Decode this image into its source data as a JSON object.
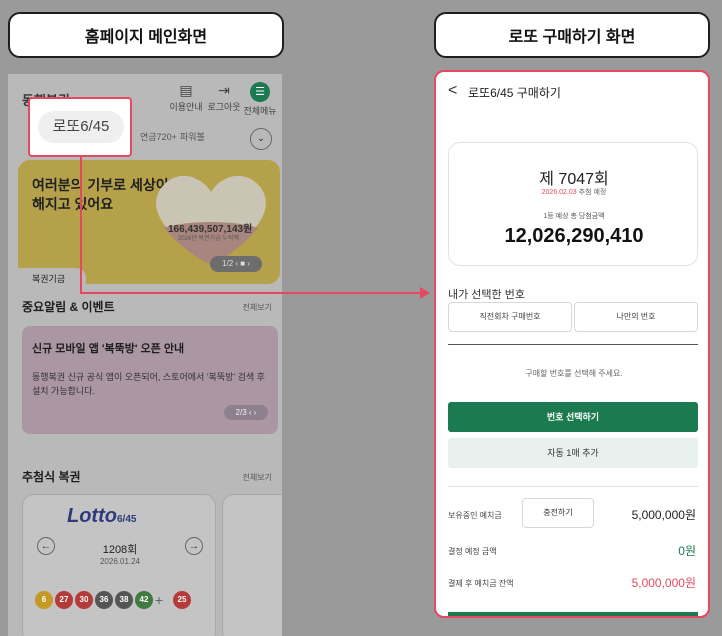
{
  "labels": {
    "left": "홈페이지 메인화면",
    "right": "로또 구매하기 화면"
  },
  "colors": {
    "accent_green": "#1b7a4f",
    "highlight_red": "#e5495f"
  },
  "home": {
    "logo": "동행복권",
    "header_icons": [
      {
        "icon": "book-icon",
        "label": "이용안내"
      },
      {
        "icon": "logout-icon",
        "label": "로그아웃"
      },
      {
        "icon": "menu-icon",
        "label": "전체메뉴"
      }
    ],
    "tabs": [
      "로또6/45",
      "연금720+",
      "파워볼"
    ],
    "tab_callout": "로또6/45",
    "banner": {
      "title": "여러분의 기부로 세상이 따듯해지고 있어요",
      "amount": "166,439,507,143원",
      "amount_sub": "2026년 복권기금 누적액",
      "pager": "1/2",
      "fund_label": "복권기금"
    },
    "events": {
      "section_title": "중요알림 & 이벤트",
      "see_all": "전체보기",
      "title": "신규 모바일 앱 '복뚝방' 오픈 안내",
      "body": "동행복권 신규 공식 앱이 오픈되어, 스토어에서 '복뚝방' 검색 후 설치 가능합니다.",
      "pager": "2/3"
    },
    "draw": {
      "section_title": "추첨식 복권",
      "see_all": "전체보기",
      "logo": "Lotto",
      "logo_suffix": "6/45",
      "round": "1208회",
      "date": "2026.01.24",
      "balls": [
        "6",
        "27",
        "30",
        "36",
        "38",
        "42"
      ],
      "bonus": "25",
      "plus": "+"
    }
  },
  "purchase": {
    "back": "<",
    "title": "로또6/45 구매하기",
    "round": "제 7047회",
    "draw_date": "2026.02.03",
    "draw_suffix": "추첨 예정",
    "prize_label": "1등 예상 총 당첨금액",
    "prize": "12,026,290,410",
    "section_title": "내가 선택한 번호",
    "pick_buttons": [
      "직전회차 구매번호",
      "나만의 번호"
    ],
    "hint": "구매할 번호를 선택해 주세요.",
    "select_button": "번호 선택하기",
    "auto_button": "자동 1매 추가",
    "deposit_label": "보유중인 예치금",
    "charge_button": "충전하기",
    "deposit_value": "5,000,000원",
    "payment_label": "결정 예정 금액",
    "payment_value": "0원",
    "balance_label": "결제 후 예치금 잔액",
    "balance_value": "5,000,000원"
  }
}
